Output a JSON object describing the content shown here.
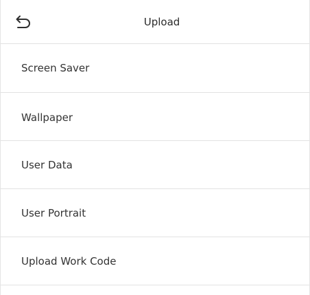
{
  "header": {
    "title": "Upload",
    "back_icon": "return-arrow-icon"
  },
  "menu": {
    "items": [
      {
        "label": "Screen Saver"
      },
      {
        "label": "Wallpaper"
      },
      {
        "label": "User Data"
      },
      {
        "label": "User Portrait"
      },
      {
        "label": "Upload Work Code"
      }
    ]
  },
  "colors": {
    "background": "#ffffff",
    "divider": "#e2e2e2",
    "text": "#333333"
  }
}
